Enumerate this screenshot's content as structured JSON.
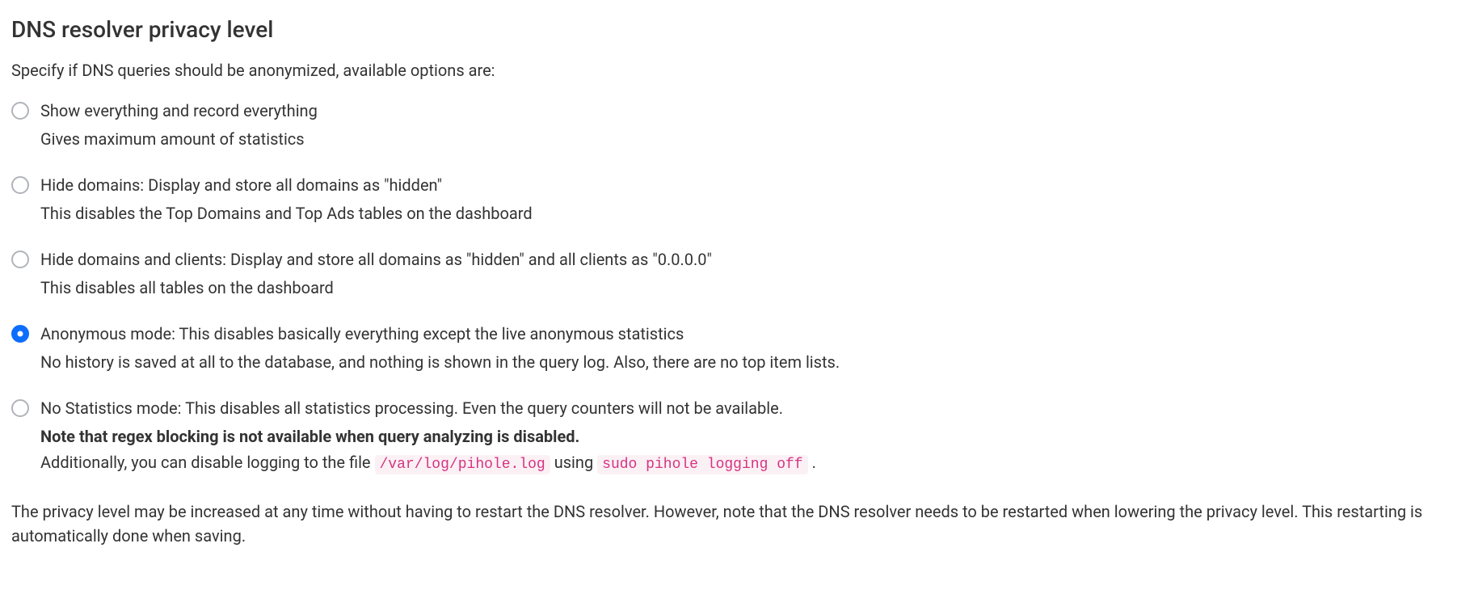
{
  "title": "DNS resolver privacy level",
  "intro": "Specify if DNS queries should be anonymized, available options are:",
  "options": [
    {
      "label": "Show everything and record everything",
      "desc": "Gives maximum amount of statistics",
      "selected": false
    },
    {
      "label": "Hide domains: Display and store all domains as \"hidden\"",
      "desc": "This disables the Top Domains and Top Ads tables on the dashboard",
      "selected": false
    },
    {
      "label": "Hide domains and clients: Display and store all domains as \"hidden\" and all clients as \"0.0.0.0\"",
      "desc": "This disables all tables on the dashboard",
      "selected": false
    },
    {
      "label": "Anonymous mode: This disables basically everything except the live anonymous statistics",
      "desc": "No history is saved at all to the database, and nothing is shown in the query log. Also, there are no top item lists.",
      "selected": true
    },
    {
      "label": "No Statistics mode: This disables all statistics processing. Even the query counters will not be available.",
      "selected": false,
      "extra": {
        "bold": "Note that regex blocking is not available when query analyzing is disabled.",
        "tail_prefix": "Additionally, you can disable logging to the file ",
        "code1": "/var/log/pihole.log",
        "mid": " using ",
        "code2": "sudo pihole logging off",
        "tail_suffix": " ."
      }
    }
  ],
  "footer": "The privacy level may be increased at any time without having to restart the DNS resolver. However, note that the DNS resolver needs to be restarted when lowering the privacy level. This restarting is automatically done when saving."
}
